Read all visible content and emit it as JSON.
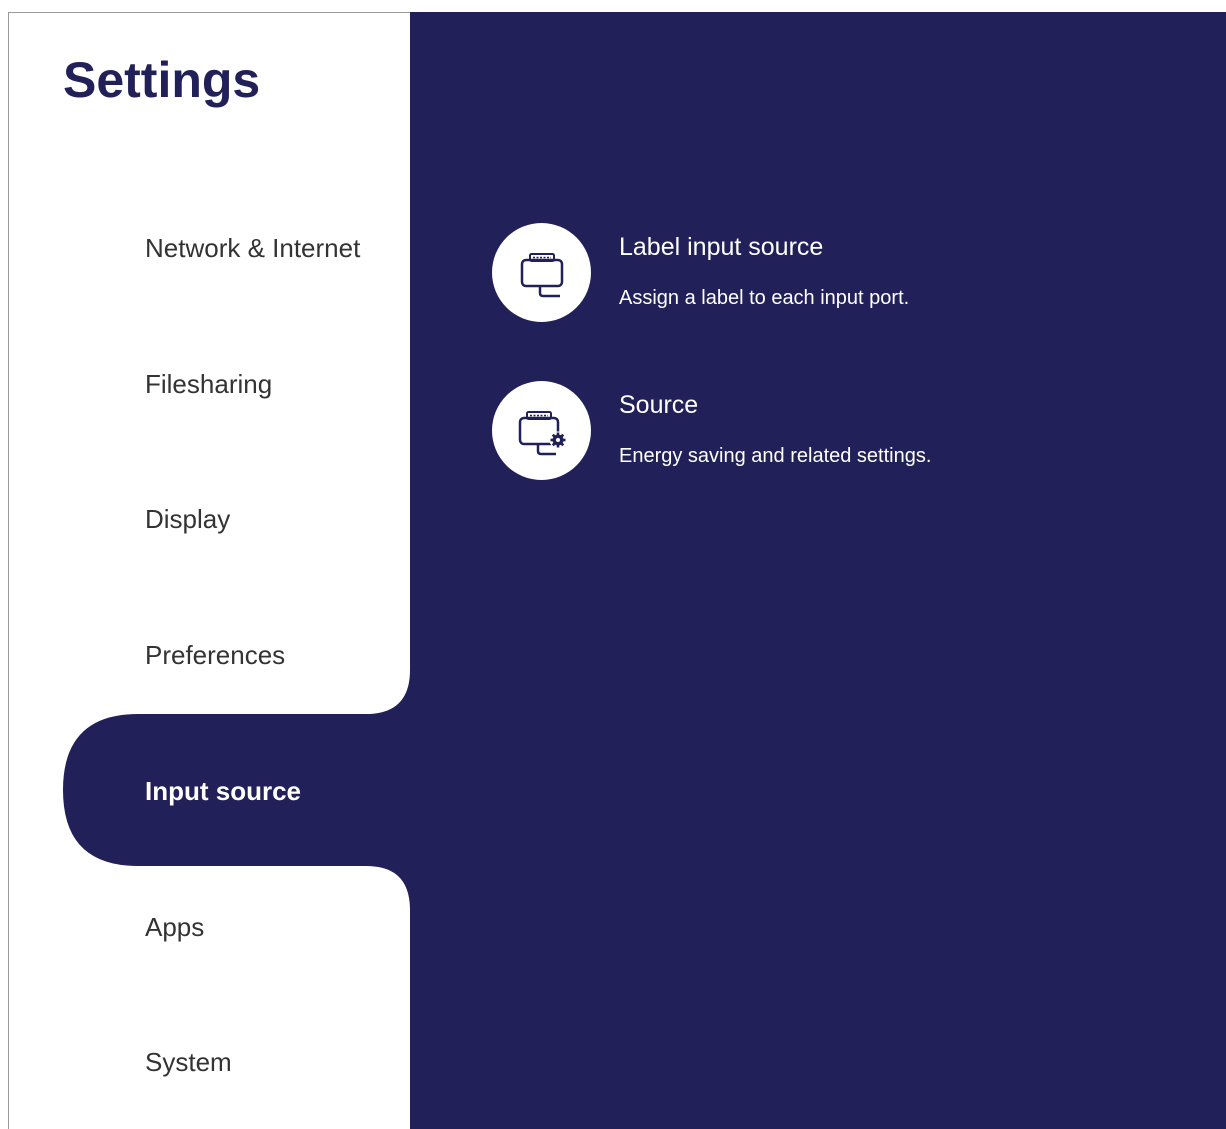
{
  "colors": {
    "navy": "#222058",
    "sidebar_bg": "#ffffff",
    "nav_text": "#333333",
    "selected_text": "#ffffff",
    "panel_text": "#ffffff"
  },
  "sidebar": {
    "title": "Settings",
    "items": [
      {
        "label": "Network & Internet",
        "selected": false
      },
      {
        "label": "Filesharing",
        "selected": false
      },
      {
        "label": "Display",
        "selected": false
      },
      {
        "label": "Preferences",
        "selected": false
      },
      {
        "label": "Input source",
        "selected": true
      },
      {
        "label": "Apps",
        "selected": false
      },
      {
        "label": "System",
        "selected": false
      }
    ]
  },
  "main": {
    "settings": [
      {
        "icon": "input-port-icon",
        "title": "Label input source",
        "description": "Assign a label to each input port."
      },
      {
        "icon": "input-port-settings-icon",
        "title": "Source",
        "description": "Energy saving and related settings."
      }
    ]
  }
}
